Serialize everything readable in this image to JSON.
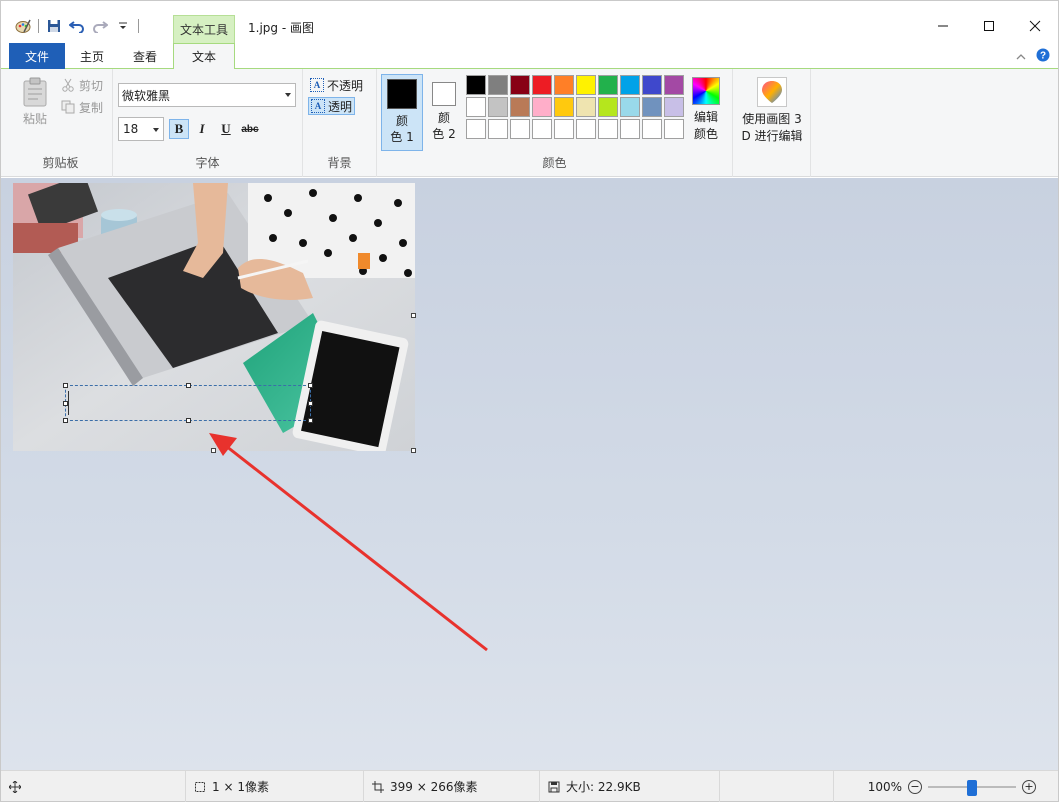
{
  "title_bar": {
    "context_tab": "文本工具",
    "title": "1.jpg - 画图"
  },
  "tabs": [
    "文件",
    "主页",
    "查看",
    "文本"
  ],
  "ribbon": {
    "clipboard": {
      "paste": "粘贴",
      "cut": "剪切",
      "copy": "复制",
      "label": "剪贴板"
    },
    "font": {
      "family": "微软雅黑",
      "size": "18",
      "bold": "B",
      "italic": "I",
      "underline": "U",
      "strikethrough": "abc",
      "label": "字体"
    },
    "background": {
      "opaque": "不透明",
      "transparent": "透明",
      "label": "背景"
    },
    "colors": {
      "color1_line1": "颜",
      "color1_line2": "色 1",
      "color2_line1": "颜",
      "color2_line2": "色 2",
      "edit_line1": "编辑",
      "edit_line2": "颜色",
      "label": "颜色",
      "color1_value": "#000000",
      "color2_value": "#ffffff",
      "palette": [
        "#000000",
        "#7f7f7f",
        "#880015",
        "#ed1c24",
        "#ff7f27",
        "#fff200",
        "#22b14c",
        "#00a2e8",
        "#3f48cc",
        "#a349a4",
        "#ffffff",
        "#c3c3c3",
        "#b97a57",
        "#ffaec9",
        "#ffc90e",
        "#efe4b0",
        "#b5e61d",
        "#99d9ea",
        "#7092be",
        "#c8bfe7",
        "#ffffff",
        "#ffffff",
        "#ffffff",
        "#ffffff",
        "#ffffff",
        "#ffffff",
        "#ffffff",
        "#ffffff",
        "#ffffff",
        "#ffffff"
      ]
    },
    "paint3d": {
      "line1": "使用画图 3",
      "line2": "D 进行编辑"
    }
  },
  "statusbar": {
    "selection_size": "1 × 1像素",
    "image_size": "399 × 266像素",
    "file_size": "大小: 22.9KB",
    "zoom": "100%",
    "zoom_fraction": 0.5
  }
}
